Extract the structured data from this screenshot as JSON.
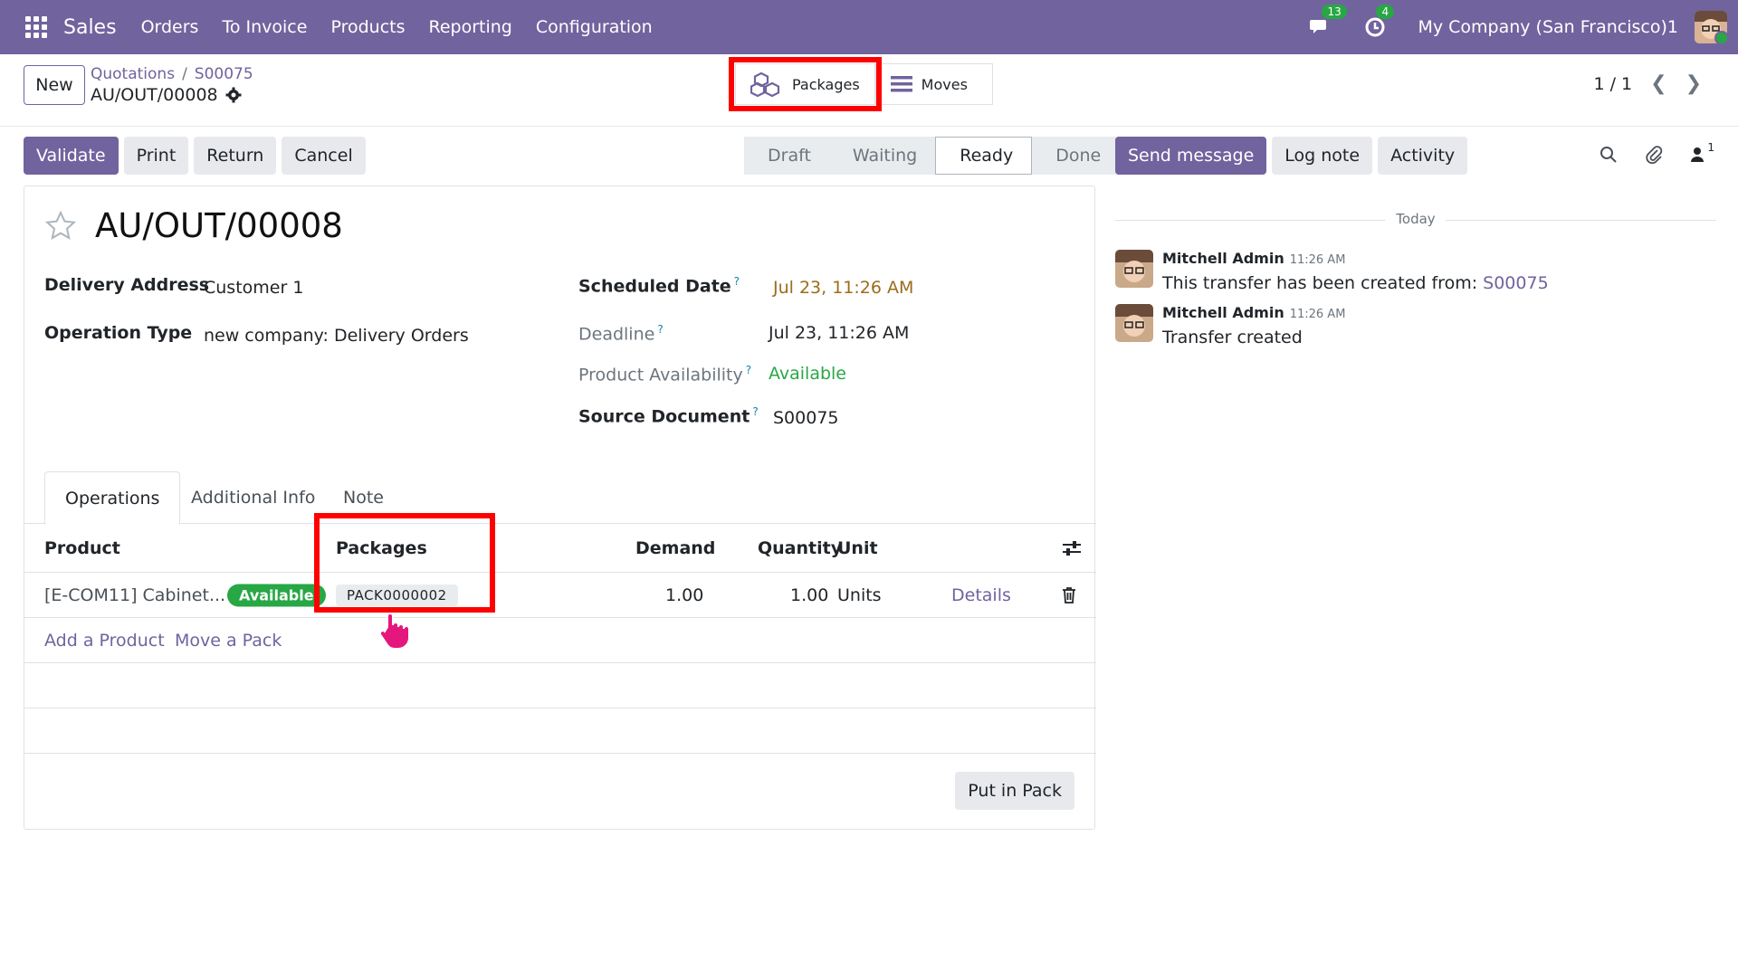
{
  "navbar": {
    "app_name": "Sales",
    "menu": [
      "Orders",
      "To Invoice",
      "Products",
      "Reporting",
      "Configuration"
    ],
    "messages_count": "13",
    "activities_count": "4",
    "company": "My Company (San Francisco)1"
  },
  "control_panel": {
    "new_label": "New",
    "breadcrumb": [
      "Quotations",
      "S00075"
    ],
    "breadcrumb_sep": "/",
    "record_name": "AU/OUT/00008",
    "smart_buttons": {
      "packages": "Packages",
      "moves": "Moves"
    },
    "pager": "1 / 1"
  },
  "actions": {
    "validate": "Validate",
    "print": "Print",
    "return": "Return",
    "cancel": "Cancel"
  },
  "statusbar": {
    "stages": [
      "Draft",
      "Waiting",
      "Ready",
      "Done"
    ],
    "active": "Ready"
  },
  "chatter_actions": {
    "send_message": "Send message",
    "log_note": "Log note",
    "activity": "Activity",
    "followers_count": "1"
  },
  "form": {
    "title": "AU/OUT/00008",
    "fields": {
      "delivery_address_label": "Delivery Address",
      "delivery_address": "Customer 1",
      "operation_type_label": "Operation Type",
      "operation_type": "new company: Delivery Orders",
      "scheduled_date_label": "Scheduled Date",
      "scheduled_date": "Jul 23, 11:26 AM",
      "deadline_label": "Deadline",
      "deadline": "Jul 23, 11:26 AM",
      "availability_label": "Product Availability",
      "availability": "Available",
      "source_document_label": "Source Document",
      "source_document": "S00075",
      "help_mark": "?"
    },
    "tabs": [
      "Operations",
      "Additional Info",
      "Note"
    ],
    "table": {
      "headers": {
        "product": "Product",
        "packages": "Packages",
        "demand": "Demand",
        "quantity": "Quantity",
        "unit": "Unit"
      },
      "rows": [
        {
          "product": "[E-COM11] Cabinet...",
          "availability": "Available",
          "package": "PACK0000002",
          "demand": "1.00",
          "quantity": "1.00",
          "unit": "Units",
          "details": "Details"
        }
      ],
      "add_product": "Add a Product",
      "move_pack": "Move a Pack"
    },
    "put_in_pack": "Put in Pack"
  },
  "chatter": {
    "date_separator": "Today",
    "messages": [
      {
        "author": "Mitchell Admin",
        "time": "11:26 AM",
        "body": "This transfer has been created from: ",
        "link": "S00075"
      },
      {
        "author": "Mitchell Admin",
        "time": "11:26 AM",
        "body": "Transfer created",
        "link": ""
      }
    ]
  },
  "colors": {
    "brand": "#71639e",
    "success": "#28a745",
    "highlight": "#ff0000",
    "warning_text": "#9a6d19"
  }
}
